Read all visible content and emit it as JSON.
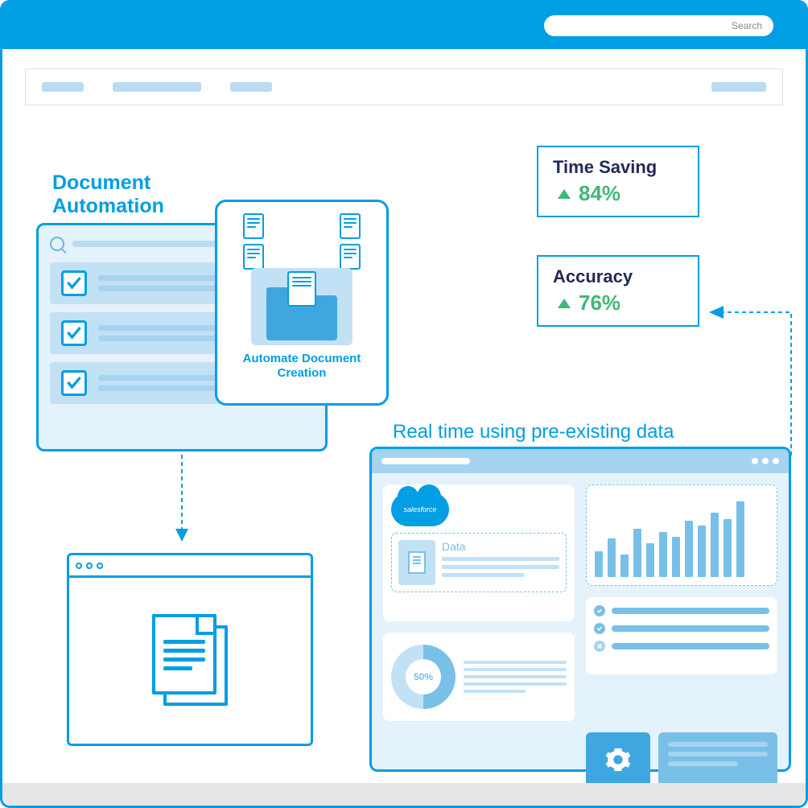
{
  "search": {
    "placeholder": "Search"
  },
  "labels": {
    "doc_auto": "Document\nAutomation",
    "auto_doc_card": "Automate Document Creation",
    "realtime": "Real time using pre-existing data"
  },
  "stats": [
    {
      "title": "Time Saving",
      "value": "84%"
    },
    {
      "title": "Accuracy",
      "value": "76%"
    }
  ],
  "dashboard": {
    "salesforce": "salesforce",
    "data_label": "Data",
    "donut": "50%",
    "bars": [
      32,
      48,
      28,
      60,
      42,
      56,
      50,
      70,
      64,
      80,
      72,
      94
    ]
  }
}
